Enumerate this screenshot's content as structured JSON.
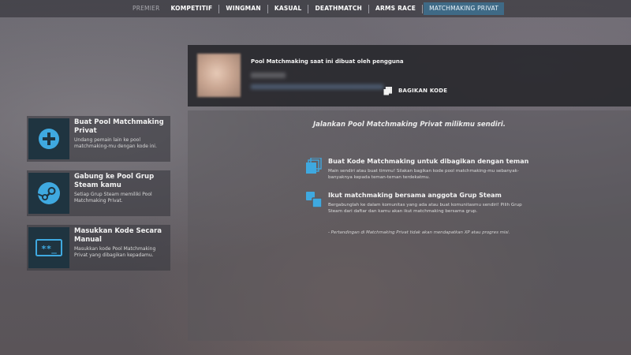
{
  "nav": {
    "items": [
      {
        "label": "PREMIER",
        "state": "dim"
      },
      {
        "label": "KOMPETITIF",
        "state": "normal"
      },
      {
        "label": "WINGMAN",
        "state": "normal"
      },
      {
        "label": "KASUAL",
        "state": "normal"
      },
      {
        "label": "DEATHMATCH",
        "state": "normal"
      },
      {
        "label": "ARMS RACE",
        "state": "normal"
      },
      {
        "label": "MATCHMAKING PRIVAT",
        "state": "active"
      }
    ]
  },
  "cards": [
    {
      "icon": "plus-icon",
      "title": "Buat Pool Matchmaking Privat",
      "desc": "Undang pemain lain ke pool matchmaking-mu dengan kode ini."
    },
    {
      "icon": "steam-icon",
      "title": "Gabung ke Pool Grup Steam kamu",
      "desc": "Setiap Grup Steam memiliki Pool Matchmaking Privat."
    },
    {
      "icon": "code-entry-icon",
      "title": "Masukkan Kode Secara Manual",
      "desc": "Masukkan kode Pool Matchmaking Privat yang dibagikan kepadamu.",
      "code_glyph": "**_"
    }
  ],
  "pool": {
    "title": "Pool Matchmaking saat ini dibuat oleh pengguna",
    "share_label": "BAGIKAN KODE"
  },
  "main": {
    "headline": "Jalankan Pool Matchmaking Privat milikmu sendiri.",
    "features": [
      {
        "icon": "copy-code-icon",
        "title": "Buat Kode Matchmaking untuk dibagikan dengan teman",
        "desc": "Main sendiri atau buat timmu! Silakan bagikan kode pool matchmaking-mu sebanyak-banyaknya kepada teman-teman terdekatmu."
      },
      {
        "icon": "group-icon",
        "title": "Ikut matchmaking bersama anggota Grup Steam",
        "desc": "Bergabunglah ke dalam komunitas yang ada atau buat komunitasmu sendiri! Pilih Grup Steam dari daftar dan kamu akan ikut matchmaking bersama grup."
      }
    ],
    "footnote": "- Pertandingan di Matchmaking Privat tidak akan mendapatkan XP atau progres misi."
  },
  "colors": {
    "accent": "#3fa9e0",
    "icon_box": "#1f3440",
    "active_tab": "#3f6a86"
  }
}
